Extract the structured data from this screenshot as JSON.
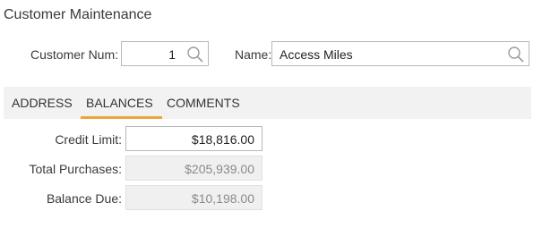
{
  "title": "Customer Maintenance",
  "customer_num": {
    "label": "Customer Num:",
    "value": "1",
    "icon": "search-icon"
  },
  "name": {
    "label": "Name:",
    "value": "Access Miles",
    "icon": "search-icon"
  },
  "tabs": [
    {
      "label": "ADDRESS",
      "active": false
    },
    {
      "label": "BALANCES",
      "active": true
    },
    {
      "label": "COMMENTS",
      "active": false
    }
  ],
  "accent_color": "#f0a33a",
  "balances": {
    "credit_limit": {
      "label": "Credit Limit:",
      "value": "$18,816.00",
      "editable": true
    },
    "total_purchases": {
      "label": "Total Purchases:",
      "value": "$205,939.00",
      "editable": false
    },
    "balance_due": {
      "label": "Balance Due:",
      "value": "$10,198.00",
      "editable": false
    }
  }
}
